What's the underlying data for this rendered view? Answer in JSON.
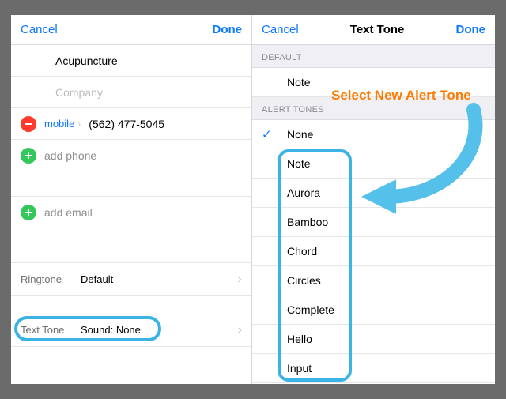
{
  "left": {
    "nav": {
      "cancel": "Cancel",
      "done": "Done"
    },
    "fields": {
      "name": "Acupuncture",
      "company_placeholder": "Company"
    },
    "phone": {
      "label": "mobile",
      "number": "(562) 477-5045"
    },
    "add_phone": "add phone",
    "add_email": "add email",
    "ringtone": {
      "label": "Ringtone",
      "value": "Default"
    },
    "texttone": {
      "label": "Text Tone",
      "value": "Sound: None"
    }
  },
  "right": {
    "nav": {
      "cancel": "Cancel",
      "title": "Text Tone",
      "done": "Done"
    },
    "default_header": "DEFAULT",
    "default_value": "Note",
    "alert_header": "ALERT TONES",
    "selected": "None",
    "tones": [
      "Note",
      "Aurora",
      "Bamboo",
      "Chord",
      "Circles",
      "Complete",
      "Hello",
      "Input"
    ]
  },
  "annotation": "Select New Alert Tone"
}
